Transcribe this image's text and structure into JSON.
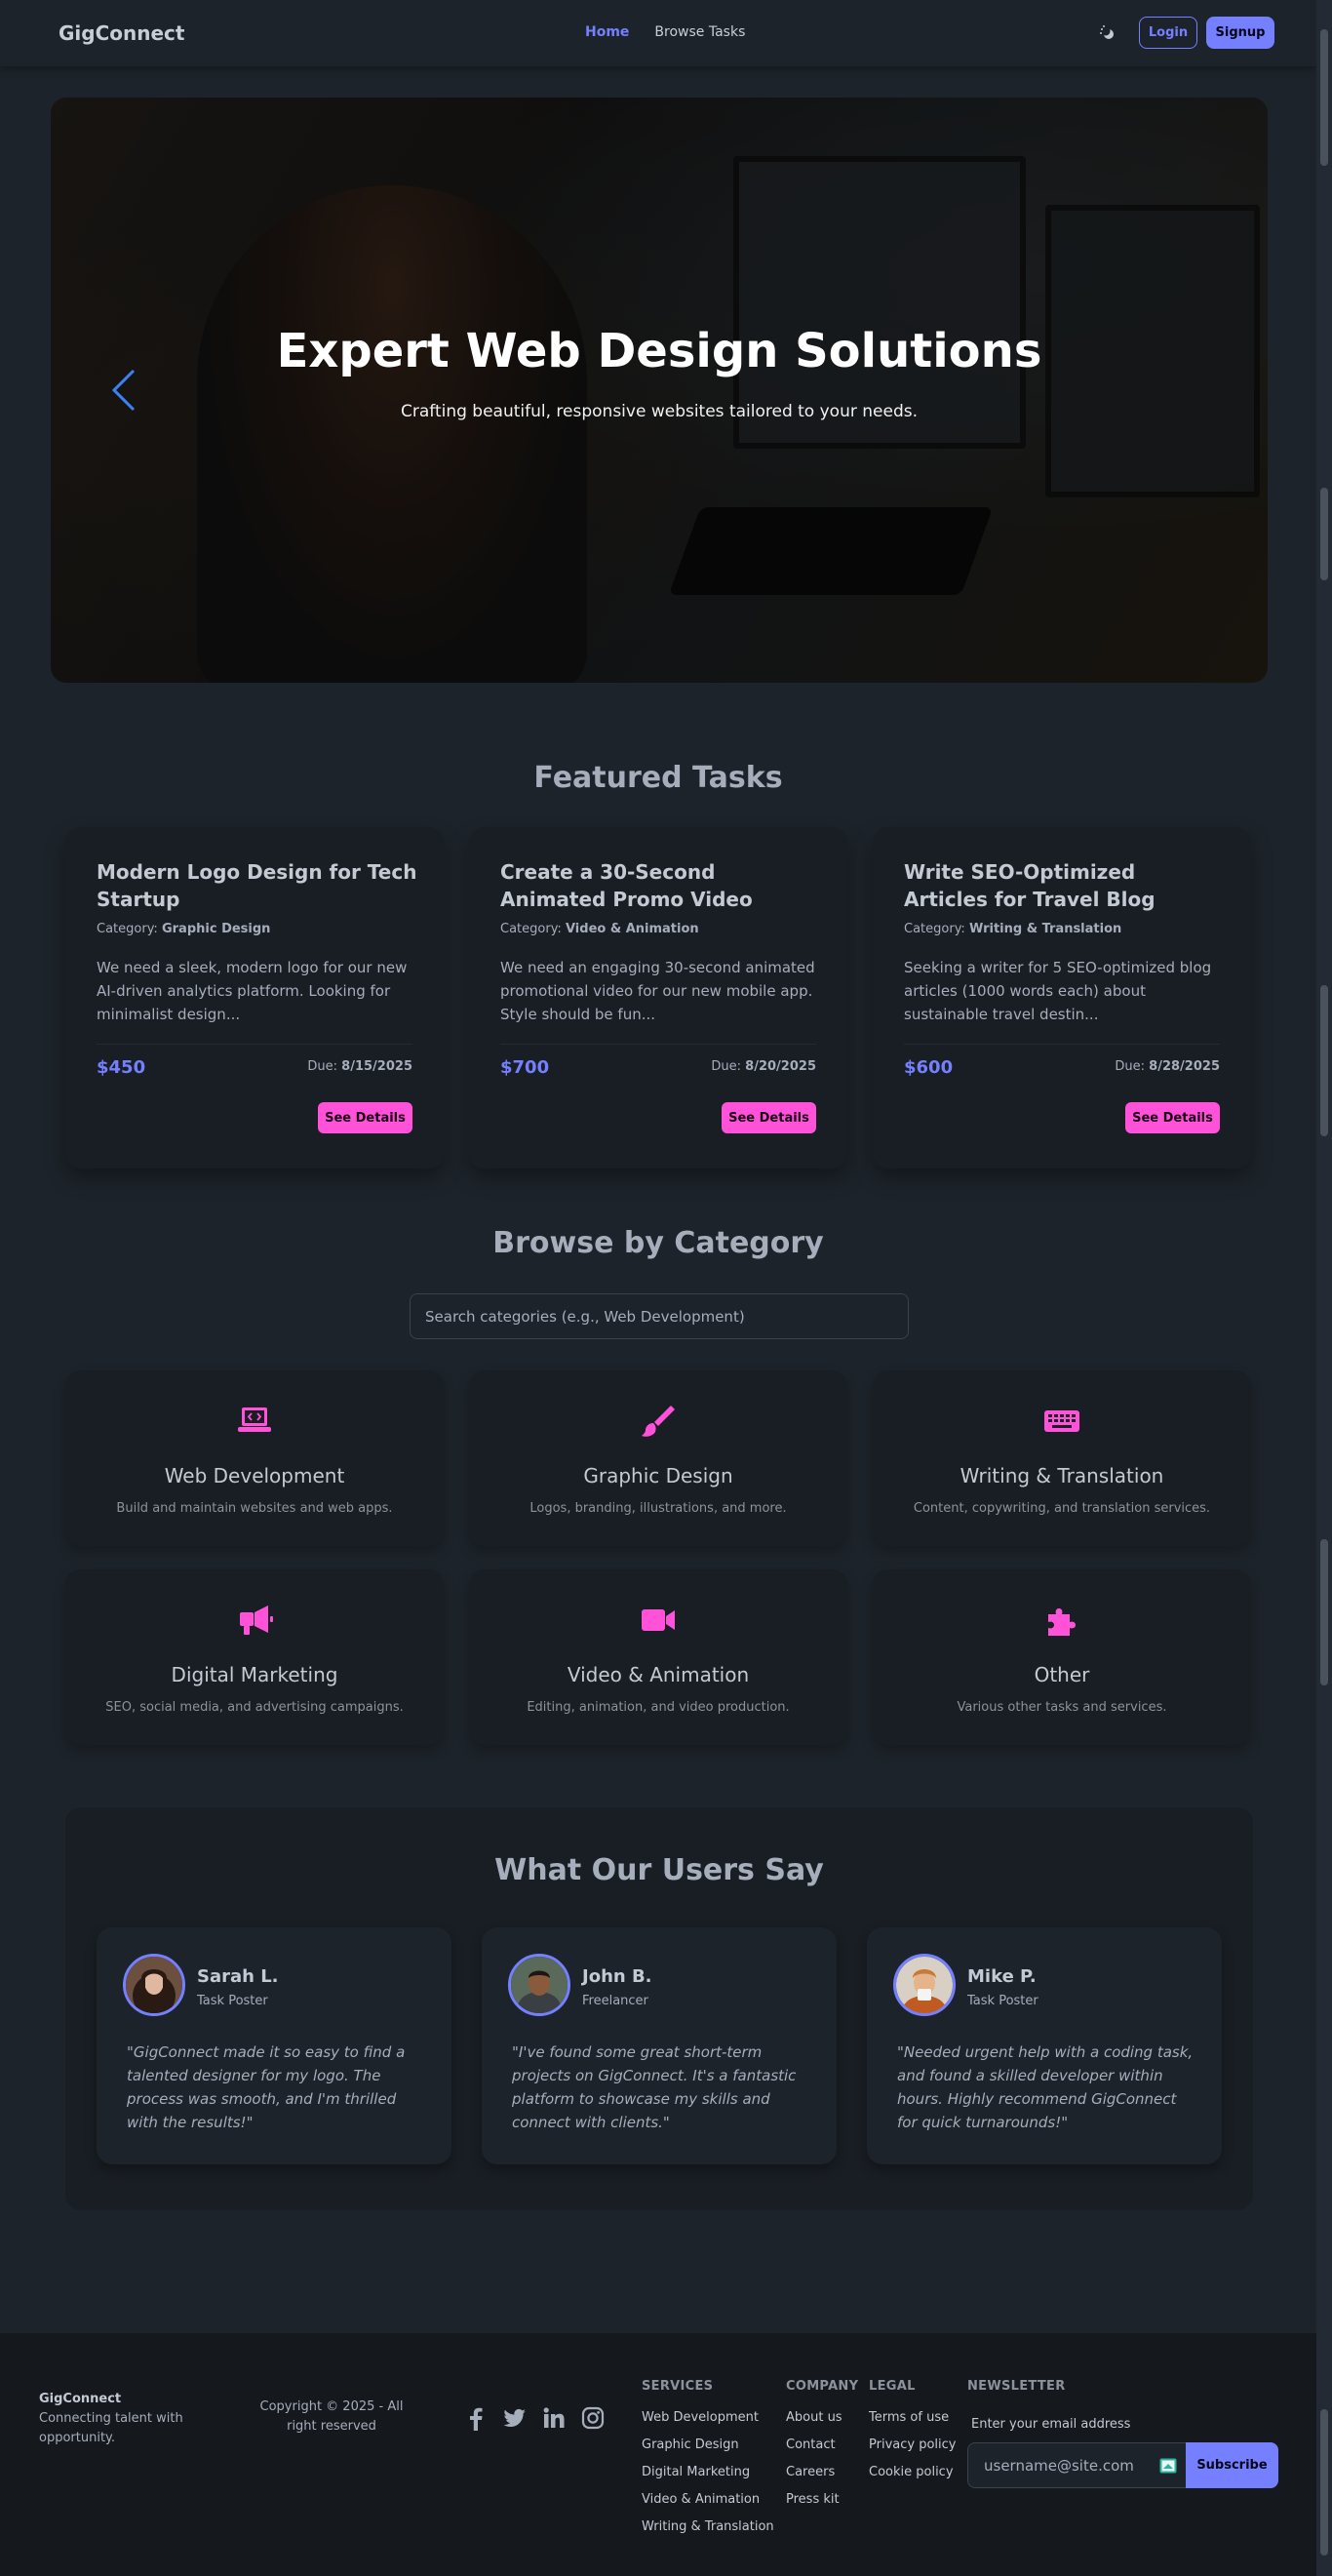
{
  "navbar": {
    "brand": "GigConnect",
    "links": [
      {
        "label": "Home",
        "active": true
      },
      {
        "label": "Browse Tasks",
        "active": false
      }
    ],
    "theme_toggle_icon": "theme-toggle-icon",
    "login_label": "Login",
    "signup_label": "Signup"
  },
  "hero": {
    "title": "Expert Web Design Solutions",
    "subtitle": "Crafting beautiful, responsive websites tailored to your needs.",
    "prev_icon": "chevron-left-icon",
    "next_icon": "chevron-right-icon",
    "active_slide": 1,
    "slide_count": 4
  },
  "featured": {
    "title": "Featured Tasks",
    "category_prefix": "Category:",
    "due_prefix": "Due:",
    "details_label": "See Details",
    "tasks": [
      {
        "title": "Modern Logo Design for Tech Startup",
        "category": "Graphic Design",
        "description": "We need a sleek, modern logo for our new AI-driven analytics platform. Looking for minimalist design...",
        "price": "$450",
        "due": "8/15/2025"
      },
      {
        "title": "Create a 30-Second Animated Promo Video",
        "category": "Video & Animation",
        "description": "We need an engaging 30-second animated promotional video for our new mobile app. Style should be fun...",
        "price": "$700",
        "due": "8/20/2025"
      },
      {
        "title": "Write SEO-Optimized Articles for Travel Blog",
        "category": "Writing & Translation",
        "description": "Seeking a writer for 5 SEO-optimized blog articles (1000 words each) about sustainable travel destin...",
        "price": "$600",
        "due": "8/28/2025"
      }
    ]
  },
  "categories": {
    "title": "Browse by Category",
    "search_placeholder": "Search categories (e.g., Web Development)",
    "items": [
      {
        "name": "Web Development",
        "description": "Build and maintain websites and web apps.",
        "icon": "laptop-code-icon"
      },
      {
        "name": "Graphic Design",
        "description": "Logos, branding, illustrations, and more.",
        "icon": "paintbrush-icon"
      },
      {
        "name": "Writing & Translation",
        "description": "Content, copywriting, and translation services.",
        "icon": "keyboard-icon"
      },
      {
        "name": "Digital Marketing",
        "description": "SEO, social media, and advertising campaigns.",
        "icon": "megaphone-icon"
      },
      {
        "name": "Video & Animation",
        "description": "Editing, animation, and video production.",
        "icon": "video-camera-icon"
      },
      {
        "name": "Other",
        "description": "Various other tasks and services.",
        "icon": "puzzle-piece-icon"
      }
    ]
  },
  "testimonials": {
    "title": "What Our Users Say",
    "items": [
      {
        "name": "Sarah L.",
        "role": "Task Poster",
        "quote": "\"GigConnect made it so easy to find a talented designer for my logo. The process was smooth, and I'm thrilled with the results!\""
      },
      {
        "name": "John B.",
        "role": "Freelancer",
        "quote": "\"I've found some great short-term projects on GigConnect. It's a fantastic platform to showcase my skills and connect with clients.\""
      },
      {
        "name": "Mike P.",
        "role": "Task Poster",
        "quote": "\"Needed urgent help with a coding task, and found a skilled developer within hours. Highly recommend GigConnect for quick turnarounds!\""
      }
    ]
  },
  "footer": {
    "brand": "GigConnect",
    "tagline": "Connecting talent with opportunity.",
    "copyright": "Copyright © 2025 - All right reserved",
    "social": [
      "facebook-icon",
      "twitter-icon",
      "linkedin-icon",
      "instagram-icon"
    ],
    "services": {
      "title": "SERVICES",
      "links": [
        "Web Development",
        "Graphic Design",
        "Digital Marketing",
        "Video & Animation",
        "Writing & Translation"
      ]
    },
    "company": {
      "title": "COMPANY",
      "links": [
        "About us",
        "Contact",
        "Careers",
        "Press kit"
      ]
    },
    "legal": {
      "title": "LEGAL",
      "links": [
        "Terms of use",
        "Privacy policy",
        "Cookie policy"
      ]
    },
    "newsletter": {
      "title": "NEWSLETTER",
      "label": "Enter your email address",
      "placeholder": "username@site.com",
      "button": "Subscribe"
    }
  },
  "colors": {
    "primary": "#7480ff",
    "secondary": "#ff52d9",
    "base": "#1d232a",
    "card": "#191e24"
  }
}
